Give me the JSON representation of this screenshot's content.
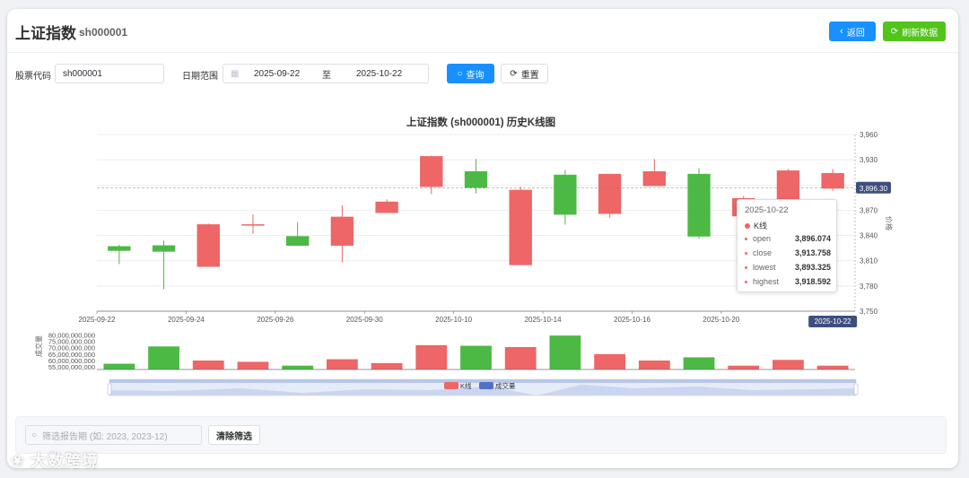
{
  "header": {
    "title": "上证指数",
    "code": "sh000001",
    "back_label": "返回",
    "refresh_label": "刷新数据"
  },
  "query": {
    "stock_code_label": "股票代码",
    "stock_code_value": "sh000001",
    "date_range_label": "日期范围",
    "start_date": "2025-09-22",
    "range_sep": "至",
    "end_date": "2025-10-22",
    "search_label": "查询",
    "reset_label": "重置"
  },
  "filter": {
    "placeholder": "筛选报告期 (如: 2023, 2023-12)",
    "clear_label": "清除筛选"
  },
  "watermark": "大数跨境",
  "colors": {
    "up": "#ee6666",
    "down": "#4cb944",
    "primary": "#1890ff",
    "success": "#52c41a",
    "axis_badge": "#3d4f7f"
  },
  "tooltip": {
    "date": "2025-10-22",
    "series": "K线",
    "rows": [
      {
        "k": "open",
        "v": "3,896.074"
      },
      {
        "k": "close",
        "v": "3,913.758"
      },
      {
        "k": "lowest",
        "v": "3,893.325"
      },
      {
        "k": "highest",
        "v": "3,918.592"
      }
    ]
  },
  "chart_data": {
    "type": "candlestick",
    "title": "上证指数 (sh000001) 历史K线图",
    "ylabel": "价格",
    "volume_label": "成交量",
    "ylim": [
      3750,
      3960
    ],
    "yticks": [
      "3,750",
      "3,780",
      "3,810",
      "3,840",
      "3,870",
      "3,900",
      "3,930",
      "3,960"
    ],
    "y_pointer": "3,896.30",
    "x_pointer": "2025-10-22",
    "x_tick_labels": [
      "2025-09-22",
      "2025-09-24",
      "2025-09-26",
      "2025-09-30",
      "2025-10-10",
      "2025-10-14",
      "2025-10-16",
      "2025-10-20"
    ],
    "volume_ticks": [
      "55,000,000,000",
      "60,000,000,000",
      "65,000,000,000",
      "70,000,000,000",
      "75,000,000,000",
      "80,000,000,000"
    ],
    "volume_ylim": [
      53000000000,
      81000000000
    ],
    "legend": [
      "K线",
      "成交量"
    ],
    "candles": [
      {
        "date": "2025-09-22",
        "open": 3827,
        "close": 3822,
        "low": 3806,
        "high": 3829,
        "volume": 57500000000
      },
      {
        "date": "2025-09-23",
        "open": 3828,
        "close": 3821,
        "low": 3776,
        "high": 3834,
        "volume": 71000000000
      },
      {
        "date": "2025-09-24",
        "open": 3803,
        "close": 3853,
        "low": 3803,
        "high": 3854,
        "volume": 60000000000
      },
      {
        "date": "2025-09-25",
        "open": 3853,
        "close": 3853,
        "low": 3842,
        "high": 3865,
        "volume": 59000000000
      },
      {
        "date": "2025-09-26",
        "open": 3839,
        "close": 3828,
        "low": 3828,
        "high": 3856,
        "volume": 56000000000
      },
      {
        "date": "2025-09-29",
        "open": 3828,
        "close": 3862,
        "low": 3808,
        "high": 3876,
        "volume": 61000000000
      },
      {
        "date": "2025-09-30",
        "open": 3867,
        "close": 3880,
        "low": 3867,
        "high": 3883,
        "volume": 58000000000
      },
      {
        "date": "2025-10-09",
        "open": 3898,
        "close": 3934,
        "low": 3889,
        "high": 3935,
        "volume": 72000000000
      },
      {
        "date": "2025-10-10",
        "open": 3916,
        "close": 3897,
        "low": 3890,
        "high": 3931,
        "volume": 71500000000
      },
      {
        "date": "2025-10-13",
        "open": 3805,
        "close": 3894,
        "low": 3805,
        "high": 3898,
        "volume": 70500000000
      },
      {
        "date": "2025-10-14",
        "open": 3912,
        "close": 3865,
        "low": 3853,
        "high": 3918,
        "volume": 79500000000
      },
      {
        "date": "2025-10-15",
        "open": 3866,
        "close": 3913,
        "low": 3861,
        "high": 3913,
        "volume": 65000000000
      },
      {
        "date": "2025-10-16",
        "open": 3899,
        "close": 3916,
        "low": 3899,
        "high": 3931,
        "volume": 60000000000
      },
      {
        "date": "2025-10-17",
        "open": 3913,
        "close": 3839,
        "low": 3836,
        "high": 3920,
        "volume": 62500000000
      },
      {
        "date": "2025-10-20",
        "open": 3863,
        "close": 3884,
        "low": 3861,
        "high": 3887,
        "volume": 56000000000
      },
      {
        "date": "2025-10-21",
        "open": 3881,
        "close": 3917,
        "low": 3880,
        "high": 3919,
        "volume": 60500000000
      },
      {
        "date": "2025-10-22",
        "open": 3896,
        "close": 3914,
        "low": 3893,
        "high": 3919,
        "volume": 56000000000
      }
    ]
  }
}
